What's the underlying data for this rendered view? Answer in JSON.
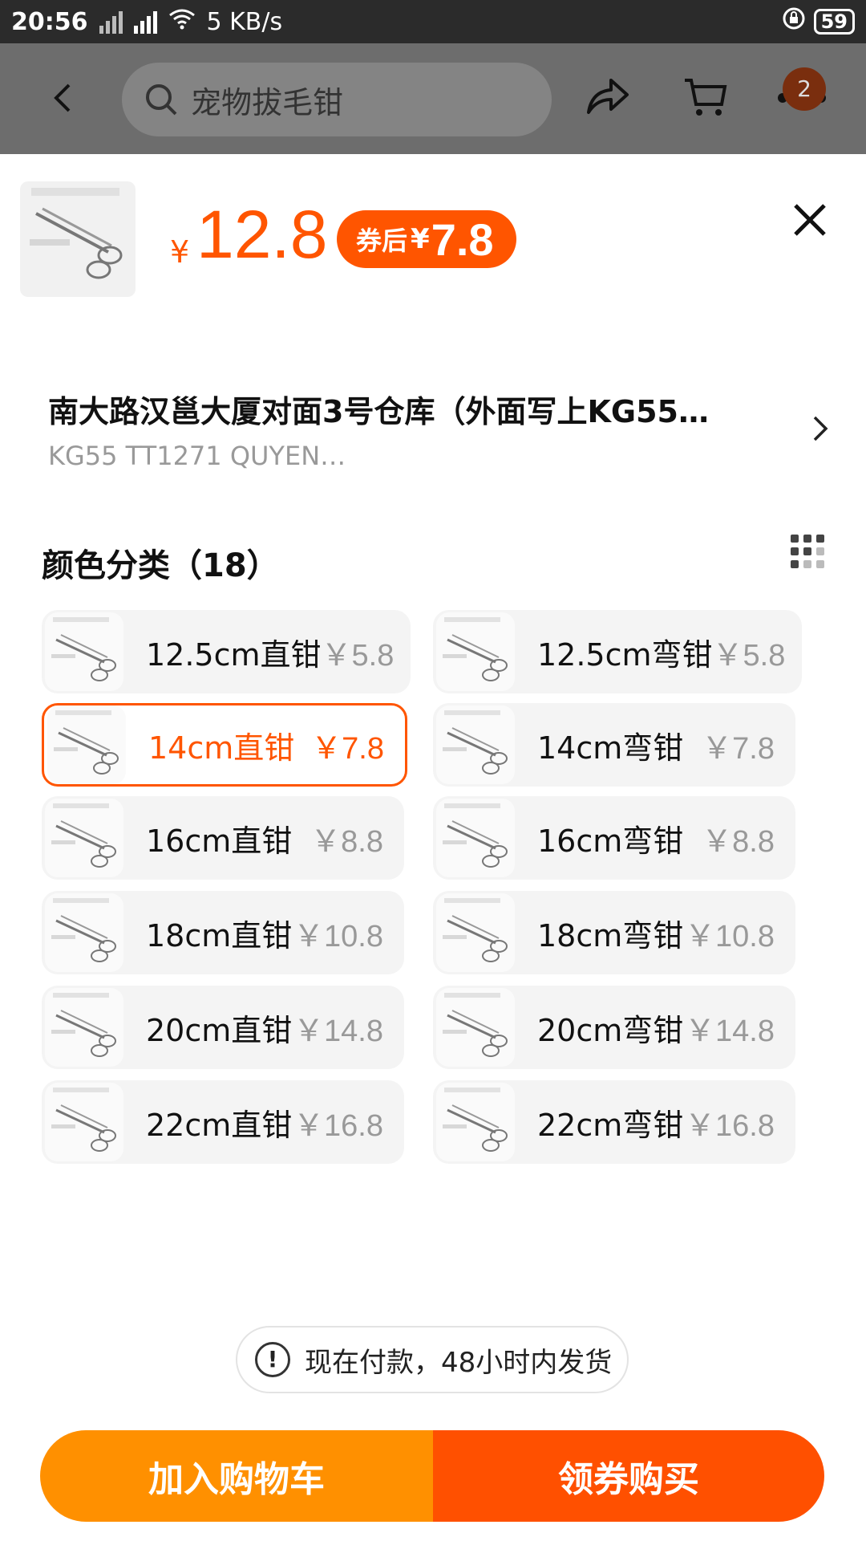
{
  "status_bar": {
    "time": "20:56",
    "network_speed": "5 KB/s",
    "battery": "59"
  },
  "top_nav": {
    "search_text": "宠物拔毛钳",
    "cart_badge": "2"
  },
  "product": {
    "price_symbol": "¥",
    "price": "12.8",
    "coupon_label": "券后",
    "coupon_symbol": "¥",
    "coupon_price": "7.8"
  },
  "address": {
    "line1": "南大路汉邕大厦对面3号仓库（外面写上KG55…",
    "line2": "KG55 TT1271 QUYEN…"
  },
  "section": {
    "title": "颜色分类（18）"
  },
  "options": [
    {
      "name": "12.5cm直钳",
      "price": "￥5.8",
      "selected": false
    },
    {
      "name": "12.5cm弯钳",
      "price": "￥5.8",
      "selected": false
    },
    {
      "name": "14cm直钳",
      "price": "￥7.8",
      "selected": true
    },
    {
      "name": "14cm弯钳",
      "price": "￥7.8",
      "selected": false
    },
    {
      "name": "16cm直钳",
      "price": "￥8.8",
      "selected": false
    },
    {
      "name": "16cm弯钳",
      "price": "￥8.8",
      "selected": false
    },
    {
      "name": "18cm直钳",
      "price": "￥10.8",
      "selected": false
    },
    {
      "name": "18cm弯钳",
      "price": "￥10.8",
      "selected": false
    },
    {
      "name": "20cm直钳",
      "price": "￥14.8",
      "selected": false
    },
    {
      "name": "20cm弯钳",
      "price": "￥14.8",
      "selected": false
    },
    {
      "name": "22cm直钳",
      "price": "￥16.8",
      "selected": false
    },
    {
      "name": "22cm弯钳",
      "price": "￥16.8",
      "selected": false
    }
  ],
  "notice": {
    "text": "现在付款，48小时内发货"
  },
  "buttons": {
    "add_to_cart": "加入购物车",
    "buy": "领券购买"
  },
  "colors": {
    "accent": "#ff5500",
    "cart_button": "#ff9000",
    "buy_button": "#ff5000"
  }
}
